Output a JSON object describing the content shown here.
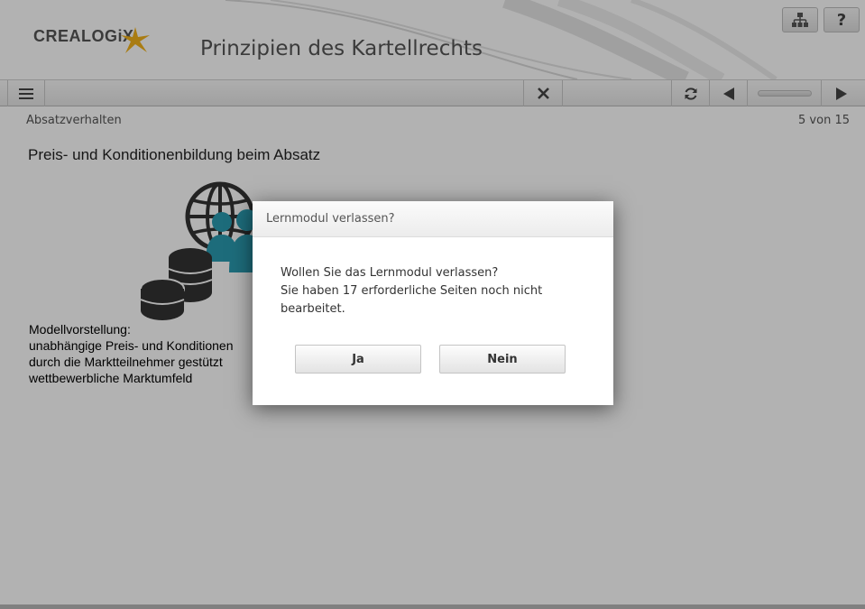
{
  "header": {
    "logo_text": "CREALOGiX",
    "title": "Prinzipien des Kartellrechts",
    "sitemap_icon": "sitemap-icon",
    "help_label": "?"
  },
  "toolbar": {
    "menu_icon": "hamburger-menu-icon",
    "close_icon": "close-icon",
    "reload_icon": "reload-icon",
    "prev_icon": "previous-arrow-icon",
    "next_icon": "next-arrow-icon",
    "progress": 0.33
  },
  "page": {
    "breadcrumb": "Absatzverhalten",
    "counter": "5 von 15",
    "title": "Preis- und Konditionenbildung beim Absatz",
    "model_lines": [
      "Modellvorstellung:",
      "unabhängige Preis- und Konditionen",
      "durch die Marktteilnehmer gestützt",
      "wettbewerbliche Marktumfeld"
    ]
  },
  "dialog": {
    "title": "Lernmodul verlassen?",
    "message_lines": [
      "Wollen Sie das Lernmodul verlassen?",
      "Sie haben 17 erforderliche Seiten noch nicht",
      "bearbeitet."
    ],
    "yes_label": "Ja",
    "no_label": "Nein"
  },
  "colors": {
    "accent_star": "#f2b21b",
    "teal_people": "#2a9bb0",
    "dark_icon": "#333333"
  }
}
